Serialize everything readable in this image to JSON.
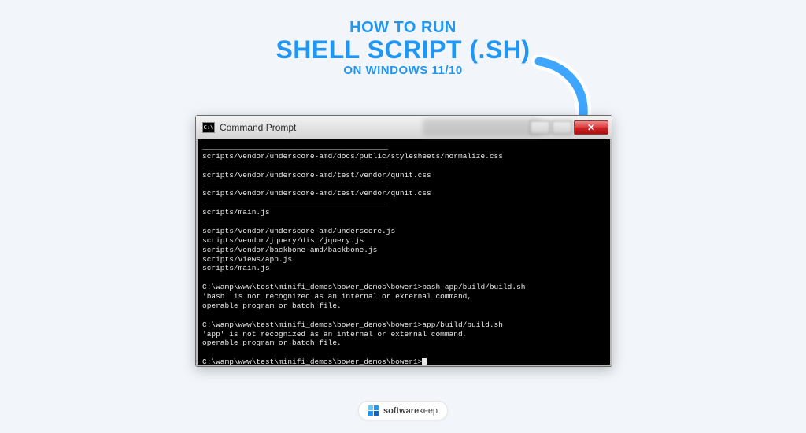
{
  "headline": {
    "line1": "HOW TO RUN",
    "line2": "SHELL SCRIPT (.SH)",
    "line3": "ON WINDOWS 11/10"
  },
  "window": {
    "title": "Command Prompt",
    "icon_label": "C:\\",
    "close_glyph": "✕"
  },
  "terminal": {
    "lines": [
      "__________________________________________________",
      "scripts/vendor/underscore-amd/docs/public/stylesheets/normalize.css",
      "__________________________________________________",
      "scripts/vendor/underscore-amd/test/vendor/qunit.css",
      "__________________________________________________",
      "scripts/vendor/underscore-amd/test/vendor/qunit.css",
      "__________________________________________________",
      "scripts/main.js",
      "__________________________________________________",
      "scripts/vendor/underscore-amd/underscore.js",
      "scripts/vendor/jquery/dist/jquery.js",
      "scripts/vendor/backbone-amd/backbone.js",
      "scripts/views/app.js",
      "scripts/main.js",
      "",
      "C:\\wamp\\www\\test\\minifi_demos\\bower_demos\\bower1>bash app/build/build.sh",
      "'bash' is not recognized as an internal or external command,",
      "operable program or batch file.",
      "",
      "C:\\wamp\\www\\test\\minifi_demos\\bower_demos\\bower1>app/build/build.sh",
      "'app' is not recognized as an internal or external command,",
      "operable program or batch file.",
      "",
      "C:\\wamp\\www\\test\\minifi_demos\\bower_demos\\bower1>"
    ]
  },
  "brand": {
    "bold": "software",
    "rest": "keep"
  },
  "colors": {
    "accent": "#2196f3",
    "arrow": "#3ea6ff"
  }
}
